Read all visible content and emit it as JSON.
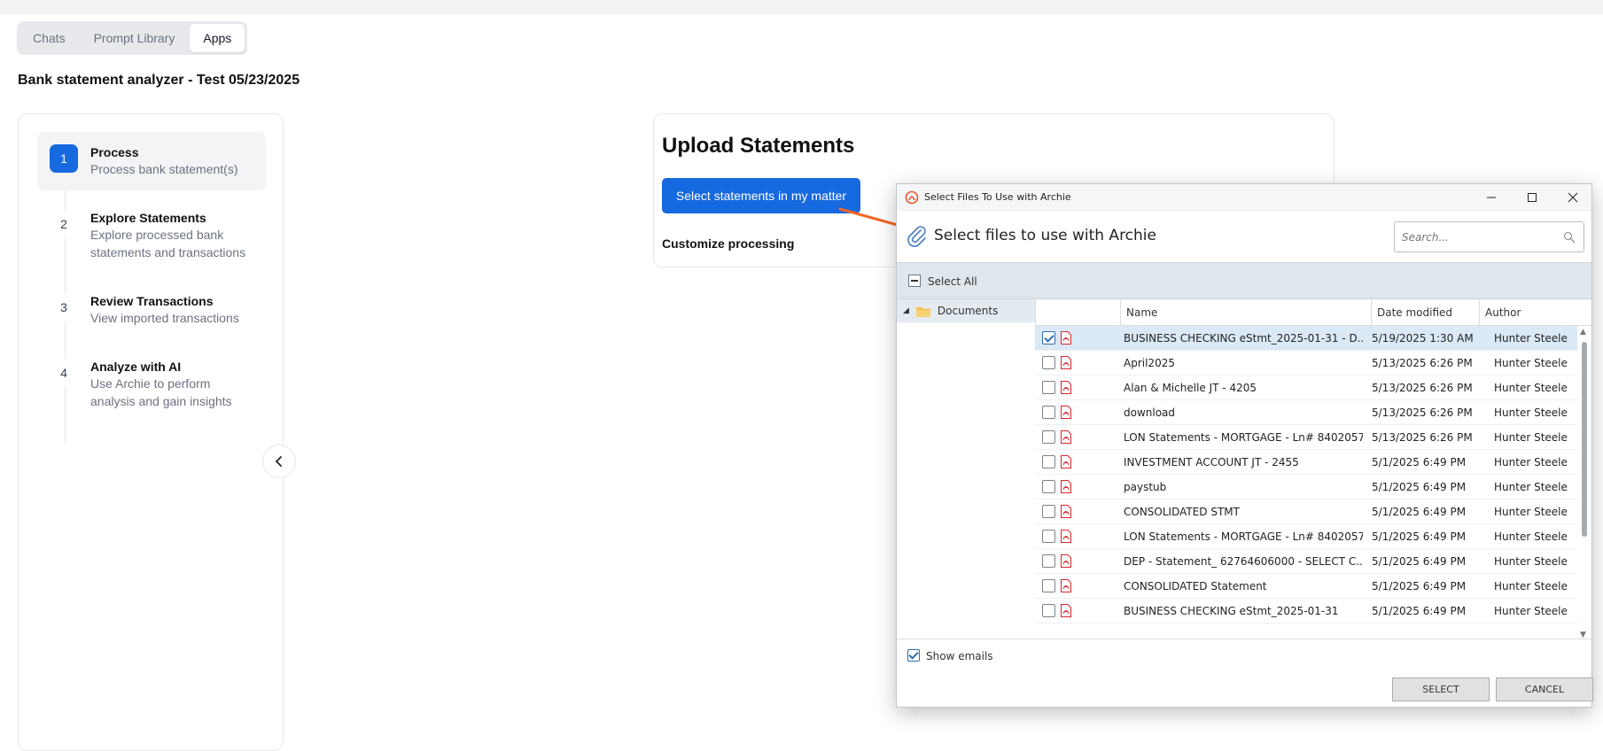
{
  "tabs": [
    {
      "label": "Chats",
      "active": false
    },
    {
      "label": "Prompt Library",
      "active": false
    },
    {
      "label": "Apps",
      "active": true
    }
  ],
  "page_title": "Bank statement analyzer - Test 05/23/2025",
  "steps": [
    {
      "num": "1",
      "title": "Process",
      "desc": "Process bank statement(s)",
      "active": true
    },
    {
      "num": "2",
      "title": "Explore Statements",
      "desc": "Explore processed bank statements and transactions",
      "active": false
    },
    {
      "num": "3",
      "title": "Review Transactions",
      "desc": "View imported transactions",
      "active": false
    },
    {
      "num": "4",
      "title": "Analyze with AI",
      "desc": "Use Archie to perform analysis and gain insights",
      "active": false
    }
  ],
  "upload": {
    "title": "Upload Statements",
    "select_button": "Select statements in my matter",
    "customize": "Customize processing"
  },
  "dialog": {
    "title": "Select Files To Use with Archie",
    "header": "Select files to use with Archie",
    "search_placeholder": "Search...",
    "select_all": "Select All",
    "tree_root": "Documents",
    "columns": {
      "name": "Name",
      "date": "Date modified",
      "author": "Author"
    },
    "rows": [
      {
        "checked": true,
        "name": "BUSINESS CHECKING eStmt_2025-01-31 - D...",
        "date": "5/19/2025 1:30 AM",
        "author": "Hunter Steele"
      },
      {
        "checked": false,
        "name": "April2025",
        "date": "5/13/2025 6:26 PM",
        "author": "Hunter Steele"
      },
      {
        "checked": false,
        "name": "Alan & Michelle JT - 4205",
        "date": "5/13/2025 6:26 PM",
        "author": "Hunter Steele"
      },
      {
        "checked": false,
        "name": "download",
        "date": "5/13/2025 6:26 PM",
        "author": "Hunter Steele"
      },
      {
        "checked": false,
        "name": "LON Statements - MORTGAGE - Ln# 8402057...",
        "date": "5/13/2025 6:26 PM",
        "author": "Hunter Steele"
      },
      {
        "checked": false,
        "name": "INVESTMENT ACCOUNT JT - 2455",
        "date": "5/1/2025 6:49 PM",
        "author": "Hunter Steele"
      },
      {
        "checked": false,
        "name": "paystub",
        "date": "5/1/2025 6:49 PM",
        "author": "Hunter Steele"
      },
      {
        "checked": false,
        "name": "CONSOLIDATED STMT",
        "date": "5/1/2025 6:49 PM",
        "author": "Hunter Steele"
      },
      {
        "checked": false,
        "name": "LON Statements - MORTGAGE - Ln# 8402057...",
        "date": "5/1/2025 6:49 PM",
        "author": "Hunter Steele"
      },
      {
        "checked": false,
        "name": "DEP - Statement_ 62764606000     - SELECT C...",
        "date": "5/1/2025 6:49 PM",
        "author": "Hunter Steele"
      },
      {
        "checked": false,
        "name": "CONSOLIDATED Statement",
        "date": "5/1/2025 6:49 PM",
        "author": "Hunter Steele"
      },
      {
        "checked": false,
        "name": "BUSINESS CHECKING eStmt_2025-01-31",
        "date": "5/1/2025 6:49 PM",
        "author": "Hunter Steele"
      }
    ],
    "show_emails": "Show emails",
    "select_button": "SELECT",
    "cancel_button": "CANCEL"
  },
  "colors": {
    "accent": "#1769e0",
    "arrow": "#f26522",
    "pdf": "#d9262b",
    "folder": "#f2c14e",
    "selected_row": "#dbe8f5"
  }
}
